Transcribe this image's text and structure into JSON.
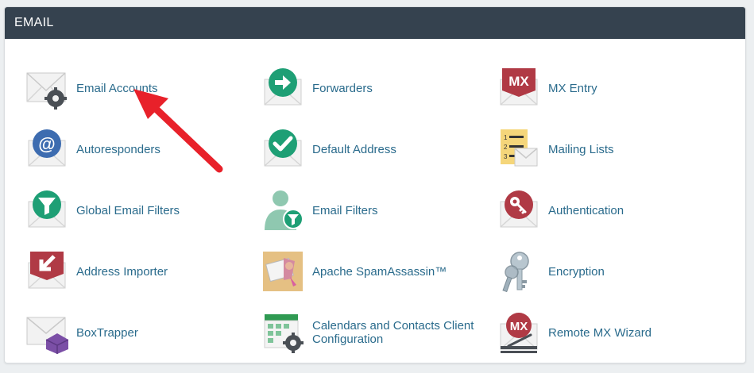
{
  "section": {
    "title": "EMAIL"
  },
  "items": [
    {
      "label": "Email Accounts"
    },
    {
      "label": "Forwarders"
    },
    {
      "label": "MX Entry"
    },
    {
      "label": "Autoresponders"
    },
    {
      "label": "Default Address"
    },
    {
      "label": "Mailing Lists"
    },
    {
      "label": "Global Email Filters"
    },
    {
      "label": "Email Filters"
    },
    {
      "label": "Authentication"
    },
    {
      "label": "Address Importer"
    },
    {
      "label": "Apache SpamAssassin™"
    },
    {
      "label": "Encryption"
    },
    {
      "label": "BoxTrapper"
    },
    {
      "label": "Calendars and Contacts Client Configuration"
    },
    {
      "label": "Remote MX Wizard"
    }
  ],
  "icon_names": {
    "mx": "MX",
    "list_numbers": [
      "1",
      "2",
      "3"
    ]
  },
  "colors": {
    "header_bg": "#35424f",
    "link": "#2a6b8c",
    "green": "#1e9f75",
    "blue": "#3d6cb0",
    "red": "#b03a45",
    "annotation_arrow": "#e8212a"
  }
}
